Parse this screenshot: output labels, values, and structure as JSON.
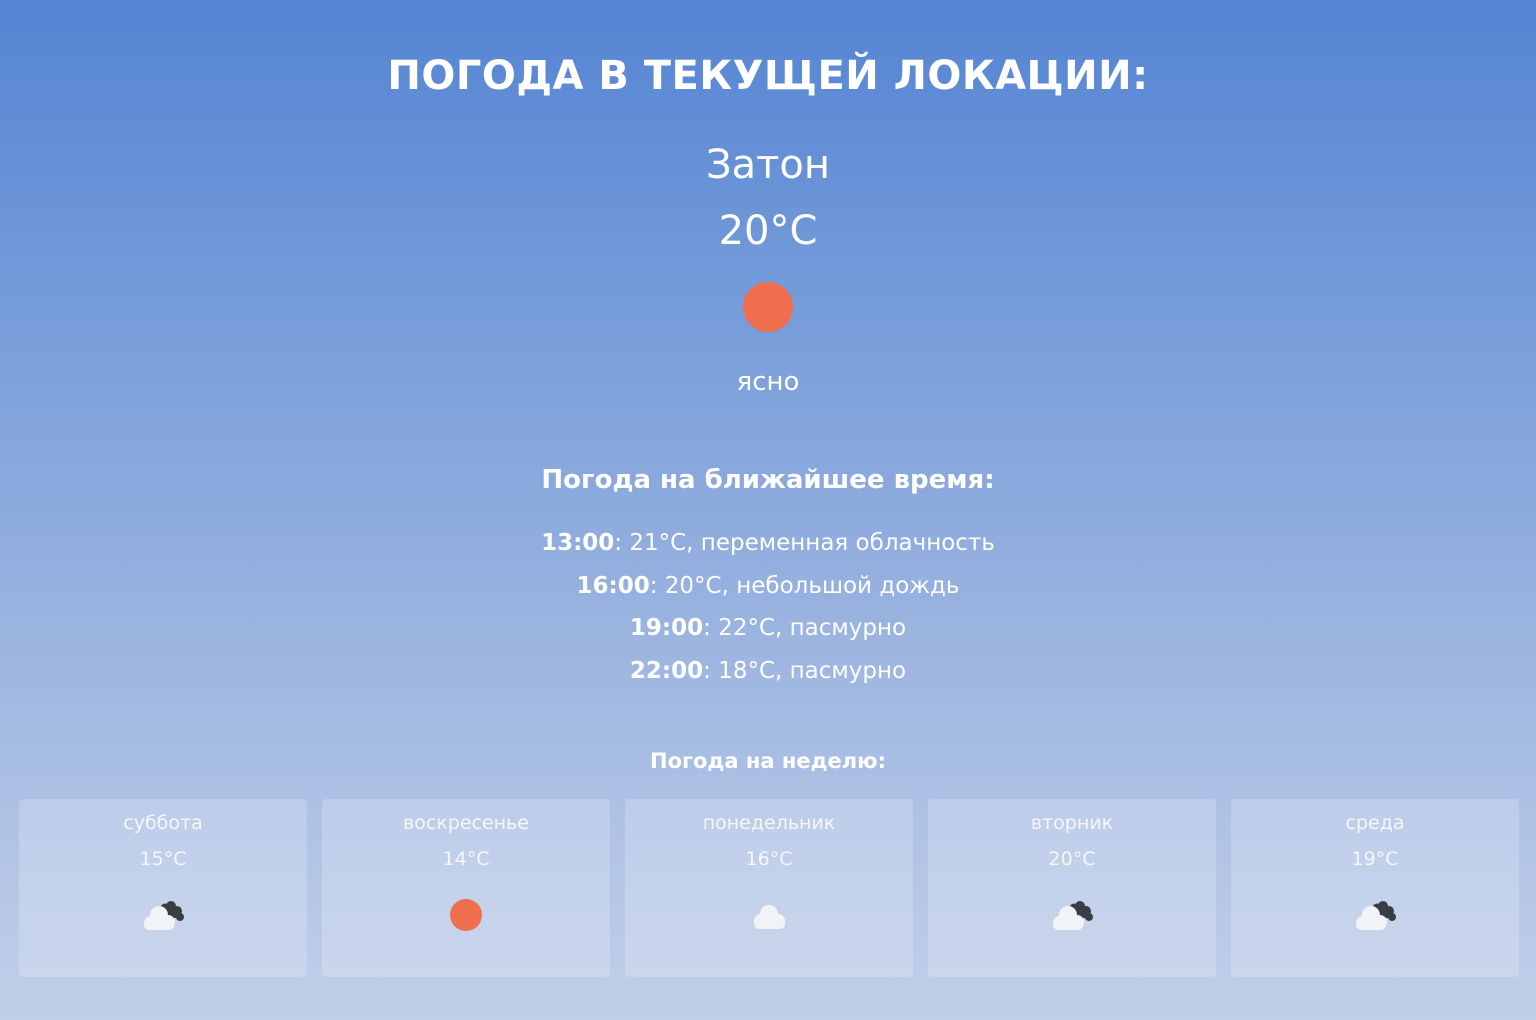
{
  "title": "ПОГОДА В ТЕКУЩЕЙ ЛОКАЦИИ:",
  "current": {
    "city": "Затон",
    "temp": "20°C",
    "icon": "sun-icon",
    "condition": "ясно"
  },
  "hourly": {
    "title": "Погода на ближайшее время:",
    "items": [
      {
        "time": "13:00",
        "desc": ": 21°C, переменная облачность"
      },
      {
        "time": "16:00",
        "desc": ": 20°C, небольшой дождь"
      },
      {
        "time": "19:00",
        "desc": ": 22°C, пасмурно"
      },
      {
        "time": "22:00",
        "desc": ": 18°C, пасмурно"
      }
    ]
  },
  "weekly": {
    "title": "Погода на неделю:",
    "days": [
      {
        "name": "суббота",
        "temp": "15°C",
        "icon": "cloud-rain-icon"
      },
      {
        "name": "воскресенье",
        "temp": "14°C",
        "icon": "sun-icon"
      },
      {
        "name": "понедельник",
        "temp": "16°C",
        "icon": "cloud-icon"
      },
      {
        "name": "вторник",
        "temp": "20°C",
        "icon": "cloud-rain-icon"
      },
      {
        "name": "среда",
        "temp": "19°C",
        "icon": "cloud-rain-icon"
      }
    ]
  },
  "colors": {
    "sun": "#ee6e4d",
    "cloud": "#f2f3f6",
    "dark_cloud": "#3a3d44"
  }
}
